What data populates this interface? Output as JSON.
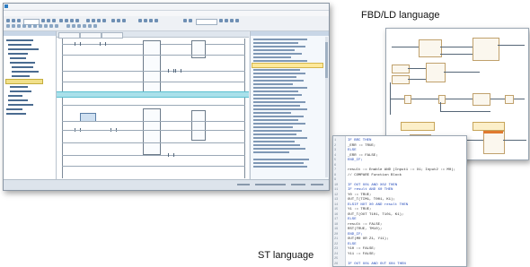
{
  "labels": {
    "fbd_ld": "FBD/LD language",
    "st": "ST language"
  },
  "ide": {
    "title": "",
    "menu": [
      "",
      "",
      "",
      "",
      "",
      "",
      "",
      ""
    ]
  },
  "st_code": [
    {
      "n": "1",
      "t": "IF BRC THEN"
    },
    {
      "n": "2",
      "t": "  _ERR := TRUE;"
    },
    {
      "n": "3",
      "t": "ELSE"
    },
    {
      "n": "4",
      "t": "  _ERR := FALSE;"
    },
    {
      "n": "5",
      "t": "END_IF;"
    },
    {
      "n": "6",
      "t": ""
    },
    {
      "n": "7",
      "t": "result := Enable AND (Input1 := X1; Input2 := M0);"
    },
    {
      "n": "8",
      "t": "// COMPARE Function Block"
    },
    {
      "n": "9",
      "t": ""
    },
    {
      "n": "10",
      "t": "IF OUT X01 AND X02 THEN"
    },
    {
      "n": "11",
      "t": "  IF result AND X0 THEN"
    },
    {
      "n": "12",
      "t": "    Y0 := TRUE;"
    },
    {
      "n": "13",
      "t": "    OUT_T(TIM1, T001, K1);"
    },
    {
      "n": "14",
      "t": "  ELSIF NOT X0 AND result THEN"
    },
    {
      "n": "15",
      "t": "    Y1 := TRUE;"
    },
    {
      "n": "16",
      "t": "    OUT_T(OUT T101, T101, K1);"
    },
    {
      "n": "17",
      "t": "  ELSE"
    },
    {
      "n": "18",
      "t": "    result := FALSE;"
    },
    {
      "n": "19",
      "t": "    RST(TRUE, TM10);"
    },
    {
      "n": "20",
      "t": "  END_IF;"
    },
    {
      "n": "21",
      "t": "  OUT(M0 OR Z1, Y11);"
    },
    {
      "n": "22",
      "t": "ELSE"
    },
    {
      "n": "23",
      "t": "Y10 := FALSE;"
    },
    {
      "n": "24",
      "t": "Y11 := FALSE;"
    },
    {
      "n": "25",
      "t": ""
    },
    {
      "n": "26",
      "t": "IF OUT X01 AND OUT X04 THEN"
    }
  ]
}
